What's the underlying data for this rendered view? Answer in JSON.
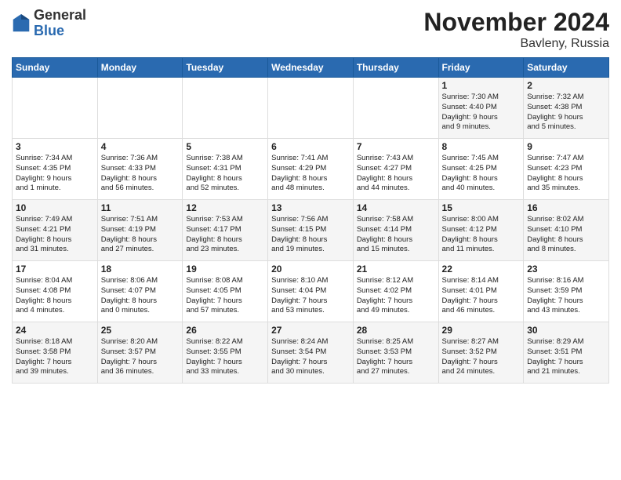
{
  "logo": {
    "general": "General",
    "blue": "Blue"
  },
  "title": "November 2024",
  "location": "Bavleny, Russia",
  "days_of_week": [
    "Sunday",
    "Monday",
    "Tuesday",
    "Wednesday",
    "Thursday",
    "Friday",
    "Saturday"
  ],
  "weeks": [
    [
      {
        "day": "",
        "info": ""
      },
      {
        "day": "",
        "info": ""
      },
      {
        "day": "",
        "info": ""
      },
      {
        "day": "",
        "info": ""
      },
      {
        "day": "",
        "info": ""
      },
      {
        "day": "1",
        "info": "Sunrise: 7:30 AM\nSunset: 4:40 PM\nDaylight: 9 hours\nand 9 minutes."
      },
      {
        "day": "2",
        "info": "Sunrise: 7:32 AM\nSunset: 4:38 PM\nDaylight: 9 hours\nand 5 minutes."
      }
    ],
    [
      {
        "day": "3",
        "info": "Sunrise: 7:34 AM\nSunset: 4:35 PM\nDaylight: 9 hours\nand 1 minute."
      },
      {
        "day": "4",
        "info": "Sunrise: 7:36 AM\nSunset: 4:33 PM\nDaylight: 8 hours\nand 56 minutes."
      },
      {
        "day": "5",
        "info": "Sunrise: 7:38 AM\nSunset: 4:31 PM\nDaylight: 8 hours\nand 52 minutes."
      },
      {
        "day": "6",
        "info": "Sunrise: 7:41 AM\nSunset: 4:29 PM\nDaylight: 8 hours\nand 48 minutes."
      },
      {
        "day": "7",
        "info": "Sunrise: 7:43 AM\nSunset: 4:27 PM\nDaylight: 8 hours\nand 44 minutes."
      },
      {
        "day": "8",
        "info": "Sunrise: 7:45 AM\nSunset: 4:25 PM\nDaylight: 8 hours\nand 40 minutes."
      },
      {
        "day": "9",
        "info": "Sunrise: 7:47 AM\nSunset: 4:23 PM\nDaylight: 8 hours\nand 35 minutes."
      }
    ],
    [
      {
        "day": "10",
        "info": "Sunrise: 7:49 AM\nSunset: 4:21 PM\nDaylight: 8 hours\nand 31 minutes."
      },
      {
        "day": "11",
        "info": "Sunrise: 7:51 AM\nSunset: 4:19 PM\nDaylight: 8 hours\nand 27 minutes."
      },
      {
        "day": "12",
        "info": "Sunrise: 7:53 AM\nSunset: 4:17 PM\nDaylight: 8 hours\nand 23 minutes."
      },
      {
        "day": "13",
        "info": "Sunrise: 7:56 AM\nSunset: 4:15 PM\nDaylight: 8 hours\nand 19 minutes."
      },
      {
        "day": "14",
        "info": "Sunrise: 7:58 AM\nSunset: 4:14 PM\nDaylight: 8 hours\nand 15 minutes."
      },
      {
        "day": "15",
        "info": "Sunrise: 8:00 AM\nSunset: 4:12 PM\nDaylight: 8 hours\nand 11 minutes."
      },
      {
        "day": "16",
        "info": "Sunrise: 8:02 AM\nSunset: 4:10 PM\nDaylight: 8 hours\nand 8 minutes."
      }
    ],
    [
      {
        "day": "17",
        "info": "Sunrise: 8:04 AM\nSunset: 4:08 PM\nDaylight: 8 hours\nand 4 minutes."
      },
      {
        "day": "18",
        "info": "Sunrise: 8:06 AM\nSunset: 4:07 PM\nDaylight: 8 hours\nand 0 minutes."
      },
      {
        "day": "19",
        "info": "Sunrise: 8:08 AM\nSunset: 4:05 PM\nDaylight: 7 hours\nand 57 minutes."
      },
      {
        "day": "20",
        "info": "Sunrise: 8:10 AM\nSunset: 4:04 PM\nDaylight: 7 hours\nand 53 minutes."
      },
      {
        "day": "21",
        "info": "Sunrise: 8:12 AM\nSunset: 4:02 PM\nDaylight: 7 hours\nand 49 minutes."
      },
      {
        "day": "22",
        "info": "Sunrise: 8:14 AM\nSunset: 4:01 PM\nDaylight: 7 hours\nand 46 minutes."
      },
      {
        "day": "23",
        "info": "Sunrise: 8:16 AM\nSunset: 3:59 PM\nDaylight: 7 hours\nand 43 minutes."
      }
    ],
    [
      {
        "day": "24",
        "info": "Sunrise: 8:18 AM\nSunset: 3:58 PM\nDaylight: 7 hours\nand 39 minutes."
      },
      {
        "day": "25",
        "info": "Sunrise: 8:20 AM\nSunset: 3:57 PM\nDaylight: 7 hours\nand 36 minutes."
      },
      {
        "day": "26",
        "info": "Sunrise: 8:22 AM\nSunset: 3:55 PM\nDaylight: 7 hours\nand 33 minutes."
      },
      {
        "day": "27",
        "info": "Sunrise: 8:24 AM\nSunset: 3:54 PM\nDaylight: 7 hours\nand 30 minutes."
      },
      {
        "day": "28",
        "info": "Sunrise: 8:25 AM\nSunset: 3:53 PM\nDaylight: 7 hours\nand 27 minutes."
      },
      {
        "day": "29",
        "info": "Sunrise: 8:27 AM\nSunset: 3:52 PM\nDaylight: 7 hours\nand 24 minutes."
      },
      {
        "day": "30",
        "info": "Sunrise: 8:29 AM\nSunset: 3:51 PM\nDaylight: 7 hours\nand 21 minutes."
      }
    ]
  ]
}
